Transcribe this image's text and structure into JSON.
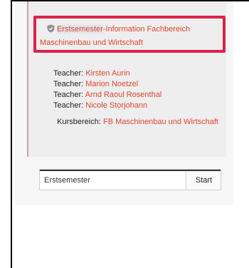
{
  "course": {
    "title_part1": "Erstsemester",
    "title_part2": "-Information Fachbereich Maschinenbau und Wirtschaft",
    "icon": "shield-icon"
  },
  "teachers": [
    {
      "label": "Teacher:",
      "name": "Kirsten Aurin"
    },
    {
      "label": "Teacher:",
      "name": "Marion Noetzel"
    },
    {
      "label": "Teacher:",
      "name": "Arnd Raoul Rosenthal"
    },
    {
      "label": "Teacher:",
      "name": "Nicole Storjohann"
    }
  ],
  "kursbereich": {
    "label": "Kursbereich:",
    "value": "FB Maschinenbau und Wirtschaft"
  },
  "search": {
    "value": "Erstsemester",
    "button_label": "Start"
  },
  "colors": {
    "link": "#e0452e",
    "highlight_border": "#d9234b"
  }
}
